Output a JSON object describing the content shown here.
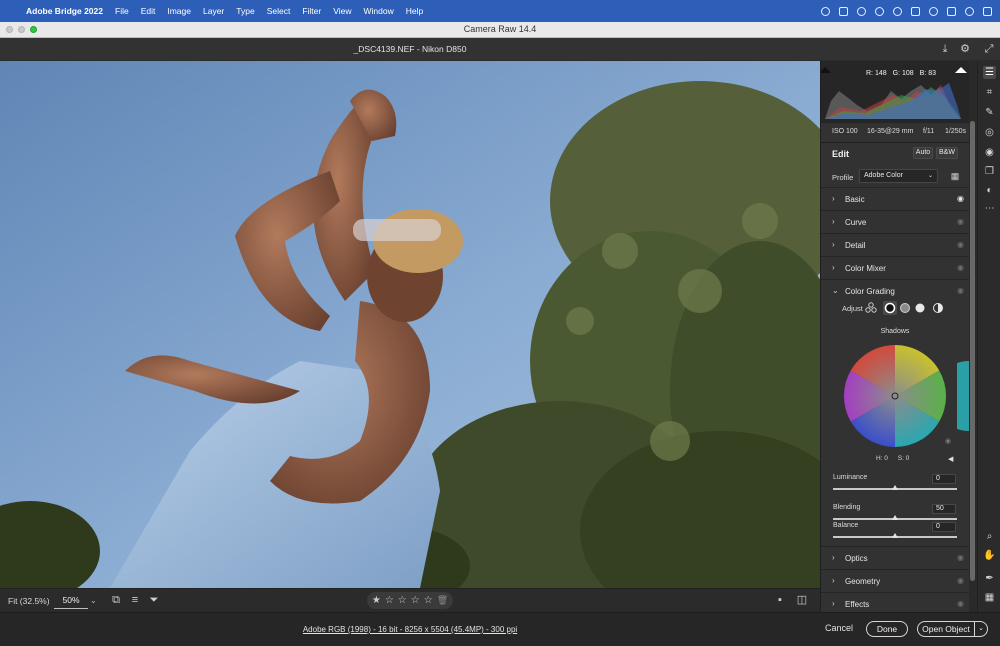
{
  "menubar": {
    "apple": "",
    "app_name": "Adobe Bridge 2022",
    "items": [
      "File",
      "Edit",
      "Image",
      "Layer",
      "Type",
      "Select",
      "Filter",
      "View",
      "Window",
      "Help"
    ]
  },
  "window": {
    "title": "Camera Raw 14.4"
  },
  "file_info": "_DSC4139.NEF  -  Nikon D850",
  "histogram": {
    "r_label": "R: 148",
    "g_label": "G: 108",
    "b_label": "B: 83"
  },
  "exif": {
    "iso": "ISO 100",
    "lens": "16-35@29 mm",
    "aperture": "f/11",
    "shutter": "1/250s"
  },
  "edit": {
    "title": "Edit",
    "auto": "Auto",
    "bw": "B&W",
    "profile_label": "Profile",
    "profile_value": "Adobe Color"
  },
  "sections_top": [
    "Basic",
    "Curve",
    "Detail",
    "Color Mixer"
  ],
  "color_grading": {
    "title": "Color Grading",
    "adjust_label": "Adjust",
    "wheel_label": "Shadows",
    "hue": "H: 0",
    "sat": "S: 0",
    "luminance_label": "Luminance",
    "luminance_value": "0",
    "blending_label": "Blending",
    "blending_value": "50",
    "balance_label": "Balance",
    "balance_value": "0",
    "luminance_level": 0,
    "blending_level": 50,
    "balance_level": 0
  },
  "sections_bottom": [
    "Optics",
    "Geometry",
    "Effects"
  ],
  "bottombar": {
    "fit": "Fit (32.5%)",
    "zoom": "50%"
  },
  "statusbar": {
    "workflow_link": "Adobe RGB (1998) - 16 bit - 8256 x 5504 (45.4MP) - 300 ppi",
    "cancel": "Cancel",
    "done": "Done",
    "open_object": "Open Object"
  },
  "colors": {
    "menubar": "#2e5fb8",
    "panel": "#323232",
    "sky": "#7fa3cc"
  }
}
